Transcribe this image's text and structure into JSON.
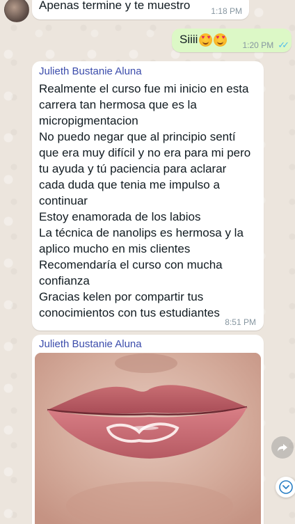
{
  "messages": [
    {
      "id": "m1",
      "direction": "incoming",
      "text": "Apenas termine y te muestro",
      "time": "1:18 PM"
    },
    {
      "id": "m2",
      "direction": "outgoing",
      "text": "Siiii",
      "emojis": [
        "heart-eyes-emoji",
        "heart-eyes-emoji"
      ],
      "time": "1:20 PM",
      "status": "read"
    },
    {
      "id": "m3",
      "direction": "incoming",
      "sender": "Julieth Bustanie Aluna",
      "lines": [
        "Realmente el curso fue mi inicio en esta",
        "carrera tan hermosa que es la",
        "micropigmentacion",
        "No puedo negar que al principio sentí",
        "que era muy difícil y no era para mi pero",
        "tu ayuda y tú paciencia para aclarar",
        "cada duda que tenia me impulso a",
        "continuar",
        "Estoy enamorada de los labios",
        "La técnica de nanolips es hermosa y la",
        "aplico mucho en mis clientes",
        "Recomendaría el curso con mucha",
        "confianza",
        "Gracias kelen por compartir tus",
        "conocimientos con tus estudiantes"
      ],
      "time": "8:51 PM"
    },
    {
      "id": "m4",
      "direction": "incoming",
      "sender": "Julieth Bustanie Aluna",
      "image": "lips-photo"
    }
  ],
  "colors": {
    "chat_background": "#ece5dd",
    "incoming_bubble": "#ffffff",
    "outgoing_bubble": "#dcf8c6",
    "sender_name": "#3b4cab",
    "read_ticks": "#53bdeb",
    "timestamp": "#8696a0"
  },
  "icons": {
    "forward": "forward-icon",
    "scroll_down": "chevron-down-icon",
    "read_status": "double-check-icon"
  }
}
